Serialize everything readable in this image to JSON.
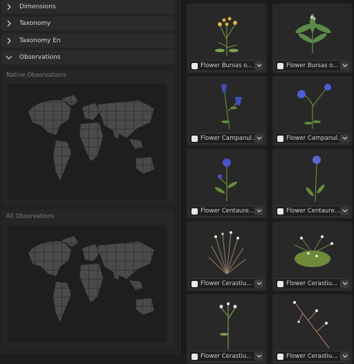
{
  "sections": [
    {
      "label": "Dimensions",
      "state": "collapsed"
    },
    {
      "label": "Taxonomy",
      "state": "collapsed"
    },
    {
      "label": "Taxonomy En",
      "state": "collapsed"
    },
    {
      "label": "Observations",
      "state": "expanded"
    }
  ],
  "observations": {
    "native_title": "Native Observations",
    "all_title": "All Observations"
  },
  "assets": [
    {
      "name": "Flower Bunias o...",
      "flower_color": "#d9b53a",
      "stem_color": "#6f8a3f"
    },
    {
      "name": "Flower Bunias o...",
      "flower_color": "#cfd6c4",
      "stem_color": "#5f8a4a"
    },
    {
      "name": "Flower Campanul...",
      "flower_color": "#3f4fb8",
      "stem_color": "#5f8a3a"
    },
    {
      "name": "Flower Campanul...",
      "flower_color": "#4a5ed6",
      "stem_color": "#5f8a3a"
    },
    {
      "name": "Flower Centaure...",
      "flower_color": "#4a55c8",
      "stem_color": "#6a8a3a"
    },
    {
      "name": "Flower Centaure...",
      "flower_color": "#5a66d0",
      "stem_color": "#6a8a3a"
    },
    {
      "name": "Flower Cerastiu...",
      "flower_color": "#e6e0d6",
      "stem_color": "#9a8468"
    },
    {
      "name": "Flower Cerastiu...",
      "flower_color": "#f0eee8",
      "stem_color": "#6f8a3a"
    },
    {
      "name": "Flower Cerastiu...",
      "flower_color": "#e8e8e8",
      "stem_color": "#7a9a58"
    },
    {
      "name": "Flower Cerastiu...",
      "flower_color": "#eeeeee",
      "stem_color": "#a27a6a"
    }
  ]
}
